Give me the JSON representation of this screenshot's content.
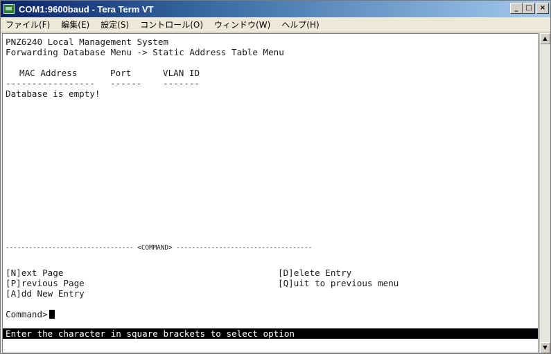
{
  "window": {
    "title": "COM1:9600baud - Tera Term VT"
  },
  "menu": {
    "items": [
      "ファイル(F)",
      "編集(E)",
      "設定(S)",
      "コントロール(O)",
      "ウィンドウ(W)",
      "ヘルプ(H)"
    ]
  },
  "terminal": {
    "header_line1": "PNZ6240 Local Management System",
    "header_line2": "Forwarding Database Menu -> Static Address Table Menu",
    "columns": {
      "mac": "MAC Address",
      "port": "Port",
      "vlan": "VLAN ID"
    },
    "underlines": {
      "mac": "-----------------",
      "port": "------",
      "vlan": "-------"
    },
    "empty_message": "Database is empty!",
    "command_separator": "--------------------------------- <COMMAND> -----------------------------------",
    "commands": {
      "next_page": "[N]ext Page",
      "previous_page": "[P]revious Page",
      "add_entry": "[A]dd New Entry",
      "delete_entry": "[D]elete Entry",
      "quit": "[Q]uit to previous menu"
    },
    "prompt": "Command>",
    "status_message": "Enter the character in square brackets to select option"
  },
  "icons": {
    "app": "tera-term-icon",
    "minimize": "minimize-icon",
    "maximize": "maximize-icon",
    "close": "close-icon",
    "scroll_up": "arrow-up-icon",
    "scroll_down": "arrow-down-icon"
  },
  "colors": {
    "titlebar_start": "#0a246a",
    "titlebar_end": "#a6caf0",
    "terminal_bg": "#ffffff",
    "terminal_fg": "#1a1a1a",
    "status_bg": "#000000",
    "status_fg": "#ffffff"
  }
}
